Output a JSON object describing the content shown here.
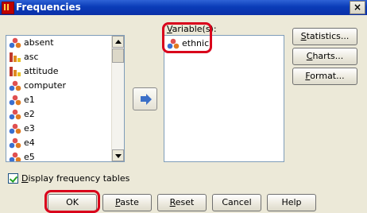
{
  "window": {
    "title": "Frequencies",
    "close_glyph": "×",
    "icon": "spss-app-icon"
  },
  "source_list": {
    "items": [
      {
        "label": "absent",
        "icon": "nominal-icon"
      },
      {
        "label": "asc",
        "icon": "scale-icon"
      },
      {
        "label": "attitude",
        "icon": "scale-icon"
      },
      {
        "label": "computer",
        "icon": "nominal-icon"
      },
      {
        "label": "e1",
        "icon": "nominal-icon"
      },
      {
        "label": "e2",
        "icon": "nominal-icon"
      },
      {
        "label": "e3",
        "icon": "nominal-icon"
      },
      {
        "label": "e4",
        "icon": "nominal-icon"
      },
      {
        "label": "e5",
        "icon": "nominal-icon"
      }
    ]
  },
  "move_button": {
    "icon": "right-arrow-icon"
  },
  "target": {
    "label_first": "V",
    "label_rest": "ariable(s):",
    "items": [
      {
        "label": "ethnic",
        "icon": "nominal-icon"
      }
    ]
  },
  "side_buttons": {
    "statistics": {
      "first": "S",
      "rest": "tatistics..."
    },
    "charts": {
      "first": "C",
      "rest": "harts..."
    },
    "format": {
      "first": "F",
      "rest": "ormat..."
    }
  },
  "checkbox": {
    "first": "D",
    "rest": "isplay frequency tables",
    "checked": true
  },
  "bottom_buttons": {
    "ok": "OK",
    "paste": {
      "first": "P",
      "rest": "aste"
    },
    "reset": {
      "first": "R",
      "rest": "eset"
    },
    "cancel": "Cancel",
    "help": "Help"
  },
  "highlight_color": "#d9001b"
}
